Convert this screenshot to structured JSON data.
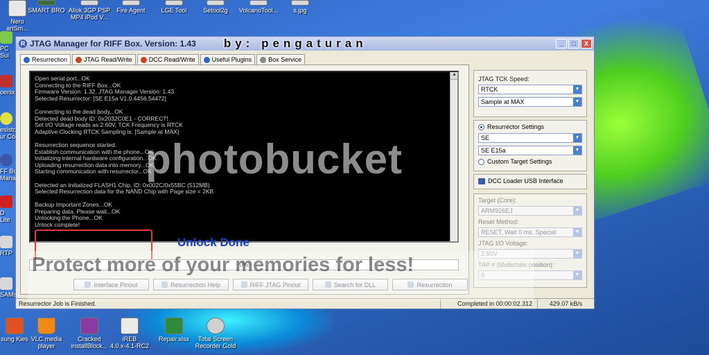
{
  "desktop": {
    "top_icons": [
      "Nero\nartSm...",
      "SMART BRO",
      "Allok 3GP PSP\nMP4 iPod V...",
      "Fire Agent",
      "LGE Tool",
      "Setool2g",
      "VolcanoTool...",
      "s.jpg"
    ],
    "left_icons": [
      "PC Sui",
      "oenix",
      "esistor\nur Co",
      "FF Box\nMana",
      "D Lite",
      "RTP",
      "SAMs"
    ],
    "bottom_icons": [
      "sung Kies",
      "VLC media\nplayer",
      "Cracked\ninstallBlock...",
      "iREB\n4.0.x-4.1-RC2",
      "Repair.xlsx",
      "Total Screen\nRecorder Gold"
    ]
  },
  "window": {
    "title": "JTAG Manager for RIFF Box. Version: 1.43",
    "overlay_text": "by: pengaturan",
    "buttons": {
      "minimize": "_",
      "maximize": "□",
      "close": "X"
    }
  },
  "tabs": [
    {
      "label": "Resurrection",
      "icon_color": "#2a66c8"
    },
    {
      "label": "JTAG Read/Write",
      "icon_color": "#d04020"
    },
    {
      "label": "DCC Read/Write",
      "icon_color": "#d04020"
    },
    {
      "label": "Useful Plugins",
      "icon_color": "#2a66c8"
    },
    {
      "label": "Box Service",
      "icon_color": "#888888"
    }
  ],
  "console": {
    "lines": [
      "Open serial port...OK",
      "Connecting to the RIFF Box...OK",
      "Firmware Version: 1.32, JTAG Manager Version: 1.43",
      "Selected Resurrector: [SE E15a V1.0.4456.54472]",
      "",
      "Connecting to the dead body...OK",
      "Detected dead body ID: 0x2032C0E1 - CORRECT!",
      "Set I/O Voltage reads as 2.60V, TCK Frequency is RTCK",
      "Adaptive Clocking RTCK Sampling is: [Sample at MAX]",
      "",
      "Resurrection sequence started.",
      "Establish communication with the phone...OK",
      "Initializing internal hardware configuration...OK",
      "Uploading resurrection data into memory...OK",
      "Starting communication with resurrector...OK",
      "",
      "Detected an Initialized FLASH1 Chip, ID: 0x002C/0x55BC (512MB)",
      "Selected Resurrection data for the NAND Chip with Page size = 2KB",
      "",
      "Backup Important Zones...OK",
      "Preparing data. Please wait...OK",
      "Unlocking the Phone...OK",
      "Unlock complete!"
    ],
    "annotation": "Unlock Done"
  },
  "progress": {
    "value_text": "0%"
  },
  "action_buttons": [
    "Interface Pinout",
    "Resurrection Help",
    "RIFF JTAG Pinout",
    "Search for DLL",
    "Resurrection"
  ],
  "right": {
    "tck_label": "JTAG TCK Speed:",
    "tck_value": "RTCK",
    "sample_value": "Sample at MAX",
    "resurrector_label": "Resurrector Settings",
    "resurrector_vendor": "SE",
    "resurrector_model": "SE E15a",
    "custom_label": "Custom Target Settings",
    "dcc_label": "DCC Loader USB Interface",
    "target_label": "Target (Core):",
    "target_value": "ARM926EJ",
    "reset_label": "Reset Method:",
    "reset_value": "RESET, Wait 0 ms, Special",
    "io_label": "JTAG I/O Voltage:",
    "io_value": "2.60V",
    "tap_label": "TAP # (Multichain position):",
    "tap_value": "0"
  },
  "status": {
    "message": "Resurrector Job is Finished.",
    "completed": "Completed in 00:00:02.312",
    "speed": "429.07 kB/s"
  },
  "watermarks": {
    "photobucket": "photobucket",
    "protect": "Protect more of your memories for less!"
  }
}
